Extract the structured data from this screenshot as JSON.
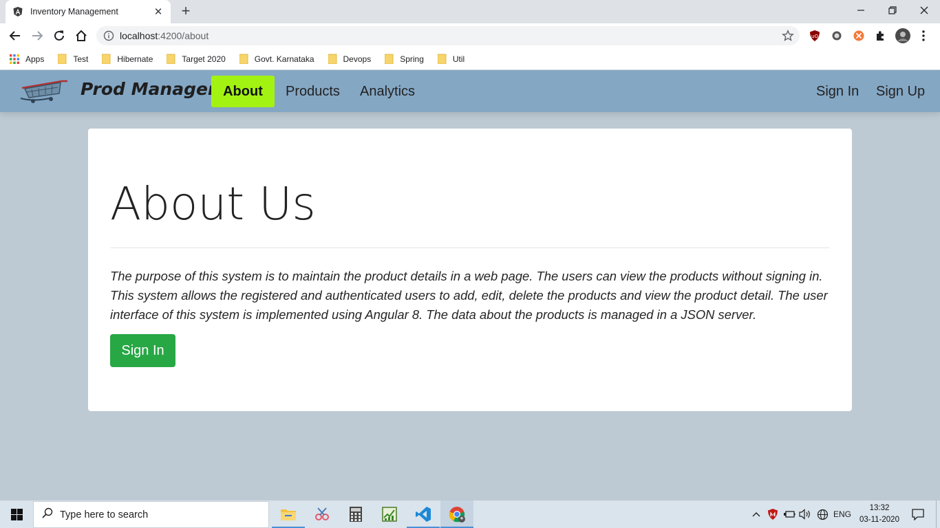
{
  "browser": {
    "tab_title": "Inventory Management",
    "url_host": "localhost",
    "url_path": ":4200/about",
    "bookmarks": [
      "Apps",
      "Test",
      "Hibernate",
      "Target 2020",
      "Govt. Karnataka",
      "Devops",
      "Spring",
      "Util"
    ]
  },
  "navbar": {
    "brand": "Prod Manager",
    "links": [
      "About",
      "Products",
      "Analytics"
    ],
    "active_link": "About",
    "right_links": [
      "Sign In",
      "Sign Up"
    ],
    "bg_color": "#84a7c4",
    "active_color": "#a2f312"
  },
  "content": {
    "heading": "About Us",
    "paragraph": "The purpose of this system is to maintain the product details in a web page. The users can view the products without signing in. This system allows the registered and authenticated users to add, edit, delete the products and view the product detail. The user interface of this system is implemented using Angular 8. The data about the products is managed in a JSON server.",
    "button_label": "Sign In",
    "button_color": "#28a745"
  },
  "taskbar": {
    "search_placeholder": "Type here to search",
    "language": "ENG",
    "time": "13:32",
    "date": "03-11-2020",
    "pinned_apps": [
      "file-explorer-icon",
      "snipping-tool-icon",
      "calculator-icon",
      "task-manager-icon",
      "vscode-icon",
      "chrome-icon"
    ]
  }
}
